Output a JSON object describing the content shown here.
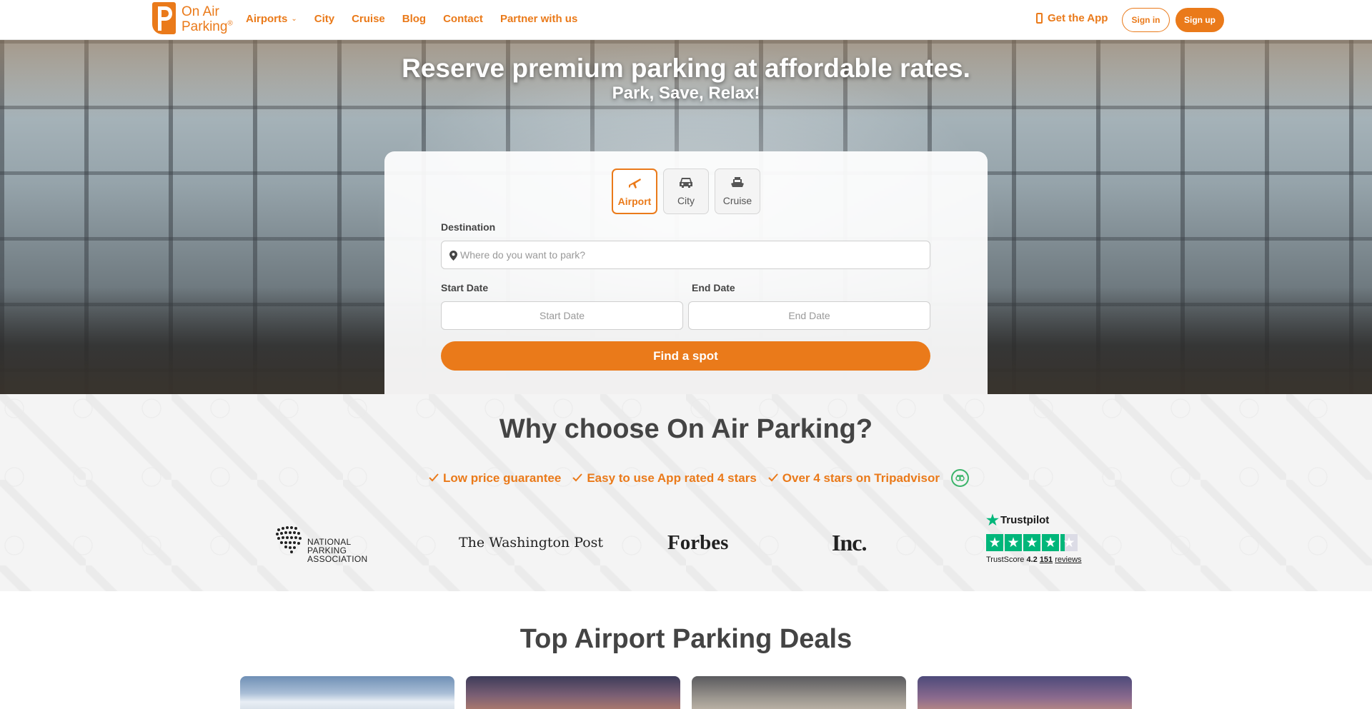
{
  "brand": {
    "line1": "On Air",
    "line2": "Parking",
    "reg": "®",
    "accent": "#ea7a1a"
  },
  "nav": {
    "items": [
      {
        "label": "Airports",
        "dropdown": true
      },
      {
        "label": "City"
      },
      {
        "label": "Cruise"
      },
      {
        "label": "Blog"
      },
      {
        "label": "Contact"
      },
      {
        "label": "Partner with us"
      }
    ],
    "get_app": "Get the App",
    "sign_in": "Sign in",
    "sign_up": "Sign up"
  },
  "hero": {
    "title": "Reserve premium parking at affordable rates.",
    "subtitle": "Park, Save, Relax!"
  },
  "search": {
    "modes": [
      {
        "label": "Airport",
        "icon": "plane-icon",
        "active": true
      },
      {
        "label": "City",
        "icon": "car-icon",
        "active": false
      },
      {
        "label": "Cruise",
        "icon": "ship-icon",
        "active": false
      }
    ],
    "destination_label": "Destination",
    "destination_placeholder": "Where do you want to park?",
    "start_label": "Start Date",
    "start_placeholder": "Start Date",
    "end_label": "End Date",
    "end_placeholder": "End Date",
    "submit": "Find a spot"
  },
  "why": {
    "title": "Why choose On Air Parking?",
    "perks": [
      "Low price guarantee",
      "Easy to use App rated 4 stars",
      "Over 4 stars on Tripadvisor"
    ],
    "press": {
      "npa": [
        "NATIONAL",
        "PARKING",
        "ASSOCIATION"
      ],
      "wapo": "The Washington Post",
      "forbes": "Forbes",
      "inc": "Inc."
    },
    "trustpilot": {
      "brand": "Trustpilot",
      "score_label": "TrustScore",
      "score": "4.2",
      "reviews_count": "151",
      "reviews_label": "reviews",
      "brand_color": "#00b67a"
    }
  },
  "deals": {
    "title": "Top Airport Parking Deals"
  }
}
